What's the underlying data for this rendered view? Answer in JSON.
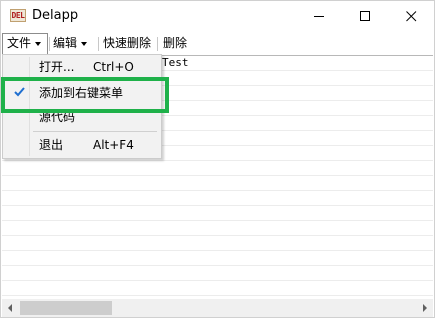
{
  "window": {
    "app_icon_text": "DEL",
    "title": "Delapp"
  },
  "menubar": {
    "file": "文件",
    "edit": "编辑",
    "quick_delete": "快速删除",
    "delete": "删除"
  },
  "file_menu": {
    "items": [
      {
        "label": "打开...",
        "shortcut": "Ctrl+O",
        "checked": false
      },
      {
        "label": "添加到右键菜单",
        "shortcut": "",
        "checked": true
      },
      {
        "label": "源代码",
        "shortcut": "",
        "checked": false
      },
      {
        "label": "退出",
        "shortcut": "Alt+F4",
        "checked": false
      }
    ]
  },
  "content": {
    "first_row_text": "Test"
  },
  "colors": {
    "highlight": "#1fb14a",
    "check": "#1f6fd0"
  },
  "icons": {
    "minimize": "minimize-icon",
    "maximize": "maximize-icon",
    "close": "close-icon",
    "check": "checkmark-icon",
    "scroll_left": "arrow-left-icon",
    "scroll_right": "arrow-right-icon"
  }
}
